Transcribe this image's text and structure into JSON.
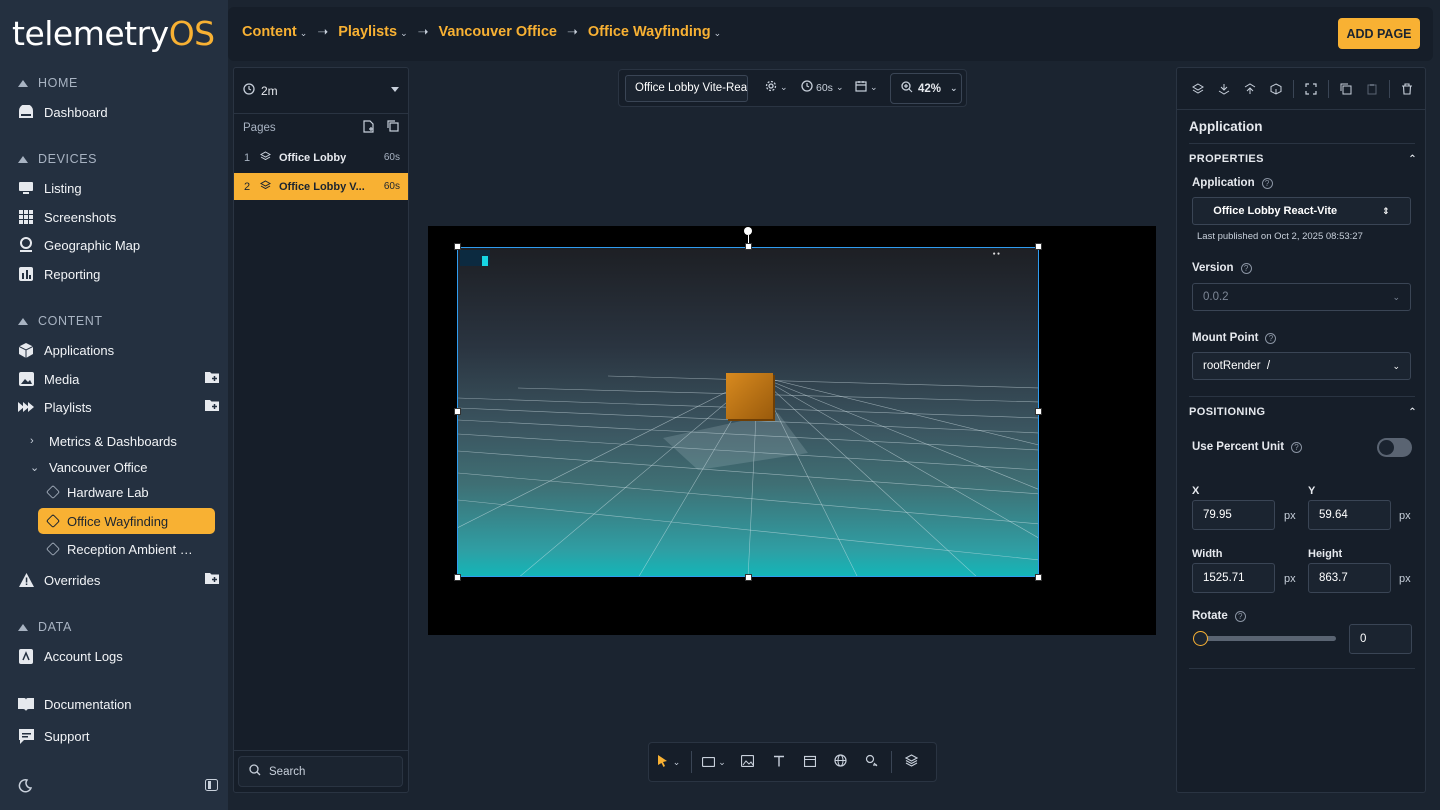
{
  "brand": {
    "name_a": "telemetry",
    "name_b": "OS"
  },
  "nav": {
    "sections": {
      "home": "HOME",
      "devices": "DEVICES",
      "content": "CONTENT",
      "data": "DATA"
    },
    "items": {
      "dashboard": "Dashboard",
      "listing": "Listing",
      "screenshots": "Screenshots",
      "geo_map": "Geographic Map",
      "reporting": "Reporting",
      "applications": "Applications",
      "media": "Media",
      "playlists": "Playlists",
      "overrides": "Overrides",
      "account_logs": "Account Logs",
      "documentation": "Documentation",
      "support": "Support"
    },
    "tree": {
      "metrics": "Metrics & Dashboards",
      "vancouver": "Vancouver Office",
      "hardware": "Hardware Lab",
      "wayfinding": "Office Wayfinding",
      "reception": "Reception Ambient …"
    }
  },
  "header": {
    "crumbs": [
      "Content",
      "Playlists",
      "Vancouver Office",
      "Office Wayfinding"
    ],
    "add_page": "ADD PAGE"
  },
  "pages_panel": {
    "duration": "2m",
    "title": "Pages",
    "rows": [
      {
        "num": "1",
        "name": "Office Lobby",
        "dur": "60s"
      },
      {
        "num": "2",
        "name": "Office Lobby V...",
        "dur": "60s"
      }
    ],
    "search_placeholder": "Search"
  },
  "canvas_toolbar": {
    "app_name": "Office Lobby Vite-React",
    "duration": "60s",
    "zoom": "42%"
  },
  "properties": {
    "title": "Application",
    "section_properties": "PROPERTIES",
    "application_label": "Application",
    "application_value": "Office Lobby React-Vite",
    "published": "Last published on Oct 2, 2025 08:53:27",
    "version_label": "Version",
    "version_value": "0.0.2",
    "mount_label": "Mount Point",
    "mount_value": "rootRender  /",
    "section_positioning": "POSITIONING",
    "percent_label": "Use Percent Unit",
    "percent_enabled": false,
    "x_label": "X",
    "x_value": "79.95",
    "y_label": "Y",
    "y_value": "59.64",
    "w_label": "Width",
    "w_value": "1525.71",
    "h_label": "Height",
    "h_value": "863.7",
    "unit": "px",
    "rotate_label": "Rotate",
    "rotate_value": "0"
  },
  "colors": {
    "accent": "#f8b133",
    "selection": "#2f9cf0",
    "panel": "#161e29",
    "nav": "#243040"
  }
}
